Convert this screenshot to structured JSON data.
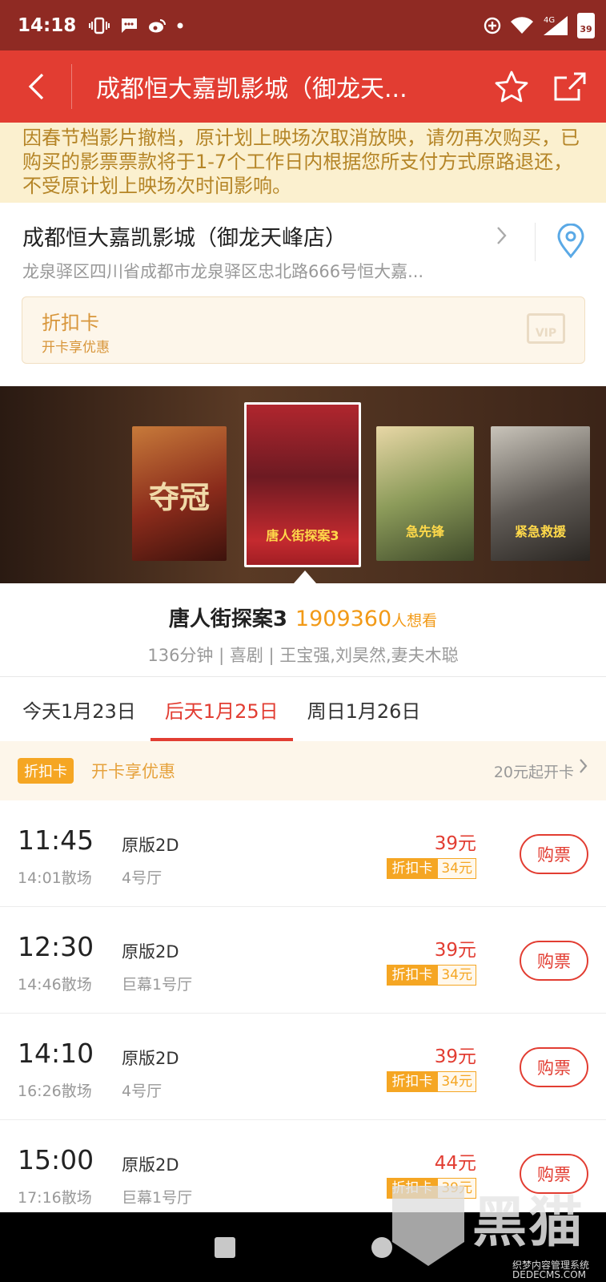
{
  "status_bar": {
    "time": "14:18",
    "network": "4G",
    "battery": "39"
  },
  "header": {
    "title": "成都恒大嘉凯影城（御龙天...",
    "back_icon": "back-arrow-icon",
    "favorite_icon": "star-icon",
    "share_icon": "share-icon"
  },
  "notice": {
    "text": "因春节档影片撤档，原计划上映场次取消放映，请勿再次购买，已购买的影票票款将于1-7个工作日内根据您所支付方式原路退还，不受原计划上映场次时间影响。"
  },
  "cinema": {
    "name": "成都恒大嘉凯影城（御龙天峰店）",
    "address": "龙泉驿区四川省成都市龙泉驿区忠北路666号恒大嘉..."
  },
  "card_banner": {
    "title": "折扣卡",
    "subtitle": "开卡享优惠",
    "badge": "VIP"
  },
  "posters": {
    "p1_label": "夺冠",
    "p2_label": "唐人街探案3",
    "p3_label": "急先锋",
    "p4_label": "紧急救援"
  },
  "movie": {
    "title": "唐人街探案3",
    "want_count": "1909360",
    "want_unit": "人想看",
    "meta": "136分钟 | 喜剧 | 王宝强,刘昊然,妻夫木聪"
  },
  "date_tabs": [
    "今天1月23日",
    "后天1月25日",
    "周日1月26日"
  ],
  "discount_row": {
    "tag": "折扣卡",
    "text": "开卡享优惠",
    "right": "20元起开卡"
  },
  "showtimes": [
    {
      "time": "11:45",
      "end": "14:01散场",
      "version": "原版2D",
      "hall": "4号厅",
      "price": "39元",
      "disc_tag": "折扣卡",
      "disc_price": "34元",
      "buy": "购票"
    },
    {
      "time": "12:30",
      "end": "14:46散场",
      "version": "原版2D",
      "hall": "巨幕1号厅",
      "price": "39元",
      "disc_tag": "折扣卡",
      "disc_price": "34元",
      "buy": "购票"
    },
    {
      "time": "14:10",
      "end": "16:26散场",
      "version": "原版2D",
      "hall": "4号厅",
      "price": "39元",
      "disc_tag": "折扣卡",
      "disc_price": "34元",
      "buy": "购票"
    },
    {
      "time": "15:00",
      "end": "17:16散场",
      "version": "原版2D",
      "hall": "巨幕1号厅",
      "price": "44元",
      "disc_tag": "折扣卡",
      "disc_price": "39元",
      "buy": "购票"
    }
  ],
  "watermark": {
    "brand": "黑猫",
    "small": "织梦内容管理系统",
    "url": "DEDECMS.COM"
  },
  "colors": {
    "brand_red": "#e23d32",
    "status_bar": "#8f2a23",
    "discount_orange": "#f5a623"
  }
}
